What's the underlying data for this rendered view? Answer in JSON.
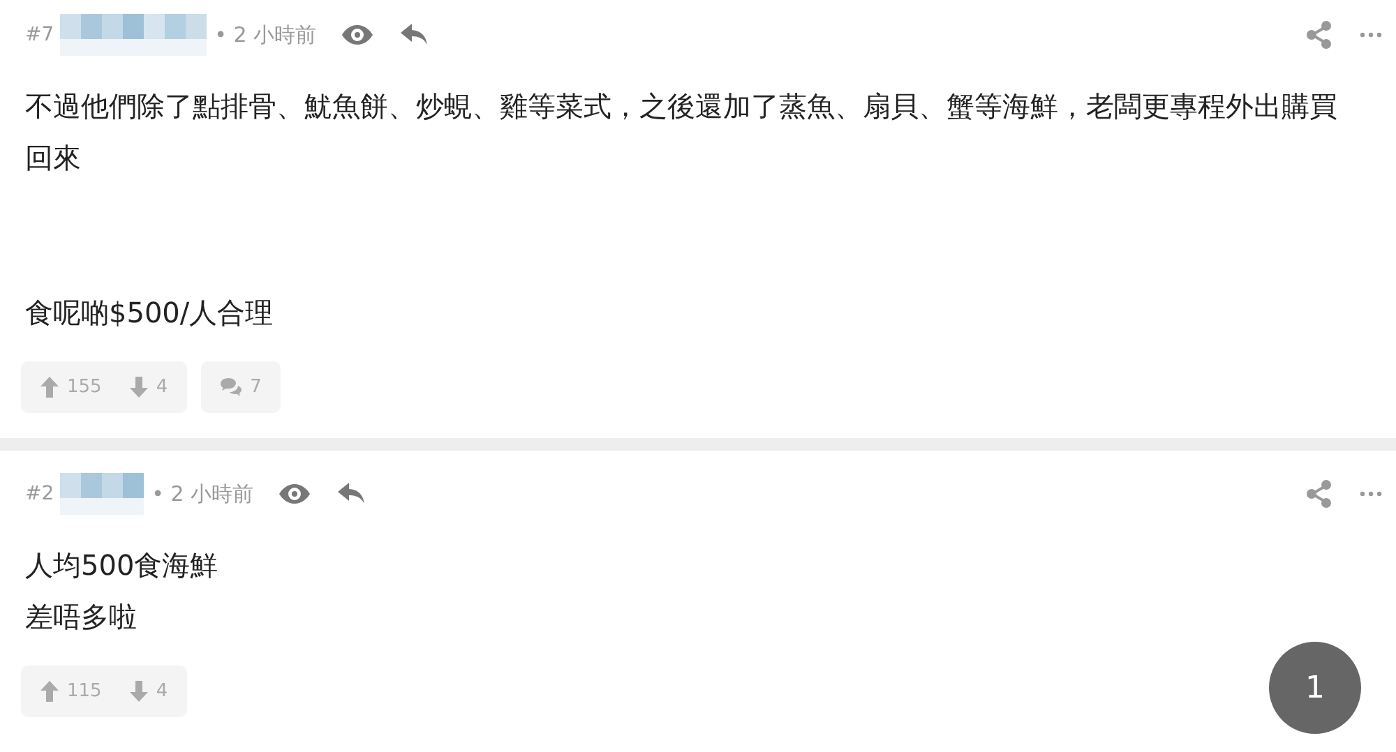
{
  "posts": [
    {
      "number": "#7",
      "time": "• 2 小時前",
      "paragraphs": [
        [
          "不過他們除了點排骨、魷魚餅、炒蜆、雞等菜式，之後還加了蒸魚、扇貝、蟹等海鮮，老闆更專程外出購買回來"
        ],
        [
          "食呢啲$500/人合理"
        ]
      ],
      "upvotes": "155",
      "downvotes": "4",
      "comments": "7"
    },
    {
      "number": "#2",
      "time": "• 2 小時前",
      "paragraphs": [
        [
          "人均500食海鮮",
          "差唔多啦"
        ]
      ],
      "upvotes": "115",
      "downvotes": "4"
    }
  ],
  "page_badge": "1"
}
